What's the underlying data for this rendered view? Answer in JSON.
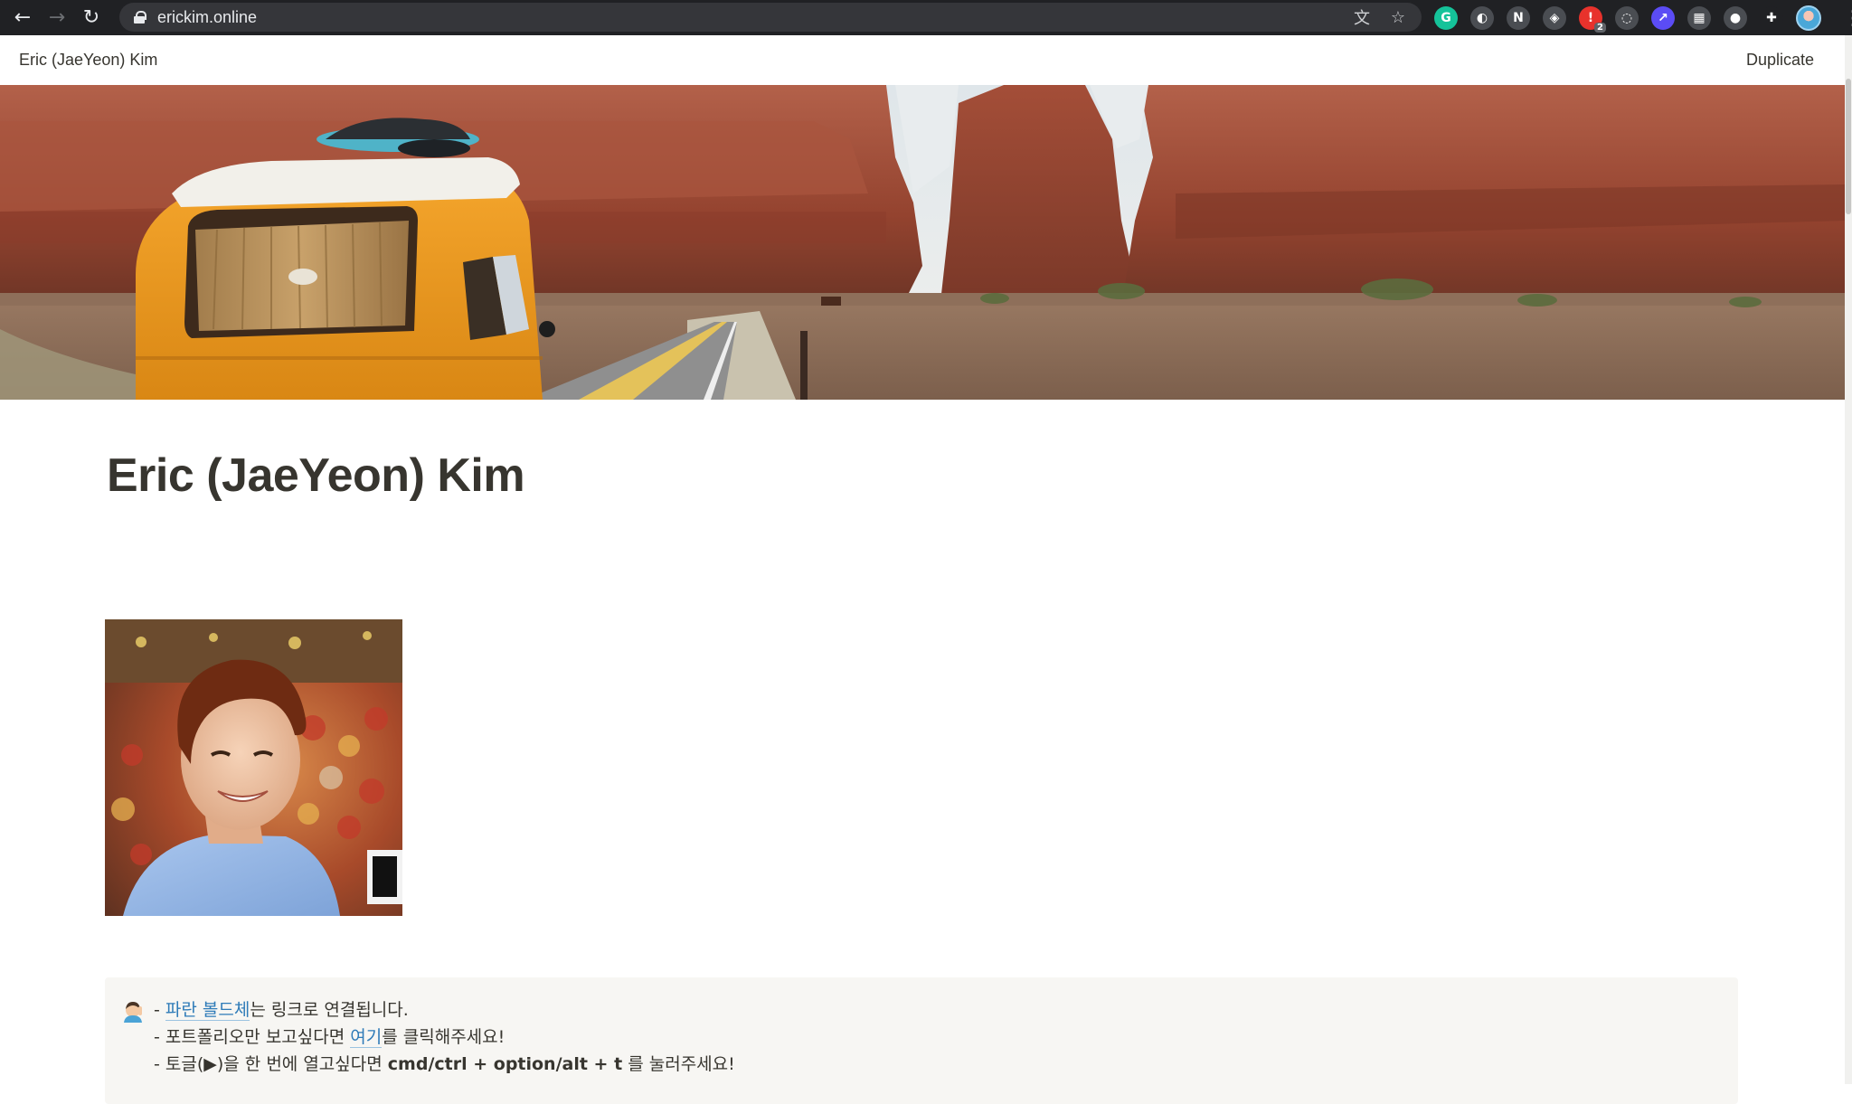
{
  "browser": {
    "url": "erickim.online",
    "back_icon": "←",
    "forward_icon": "→",
    "reload_icon": "↻",
    "translate_icon": "文",
    "star_icon": "☆",
    "extensions": [
      {
        "name": "grammarly-extension-icon",
        "glyph": "G",
        "color": "#15c39a"
      },
      {
        "name": "extension-icon-2",
        "glyph": "◐",
        "color": "#4a4d52"
      },
      {
        "name": "notion-web-clipper-icon",
        "glyph": "N",
        "color": "#4a4d52"
      },
      {
        "name": "layers-extension-icon",
        "glyph": "◈",
        "color": "#4a4d52"
      },
      {
        "name": "red-extension-icon",
        "glyph": "!",
        "color": "#e8322c",
        "badge": "2"
      },
      {
        "name": "sync-extension-icon",
        "glyph": "◌",
        "color": "#4a4d52"
      },
      {
        "name": "purple-extension-icon",
        "glyph": "↗",
        "color": "#5b4cf5"
      },
      {
        "name": "grid-extension-icon",
        "glyph": "▦",
        "color": "#4a4d52"
      },
      {
        "name": "white-circle-extension-icon",
        "glyph": "●",
        "color": "#4a4d52"
      },
      {
        "name": "puzzle-extensions-icon",
        "glyph": "✚",
        "color": "#202124"
      }
    ],
    "menu_icon": "⋮"
  },
  "topbar": {
    "title": "Eric (JaeYeon) Kim",
    "duplicate_label": "Duplicate"
  },
  "page": {
    "title": "Eric (JaeYeon) Kim"
  },
  "callout": {
    "line1": {
      "prefix": "- ",
      "link": "파란 볼드체",
      "suffix": "는 링크로 연결됩니다."
    },
    "line2": {
      "prefix": "- 포트폴리오만 보고싶다면 ",
      "link": "여기",
      "suffix": "를 클릭해주세요!"
    },
    "line3": {
      "prefix": "- 토글(▶)을 한 번에 열고싶다면 ",
      "shortcut": "cmd/ctrl + option/alt + t",
      "suffix": " 를 눌러주세요!"
    }
  },
  "colors": {
    "text": "#37352f",
    "link": "#2e7bb8",
    "callout_bg": "#f7f6f3"
  }
}
